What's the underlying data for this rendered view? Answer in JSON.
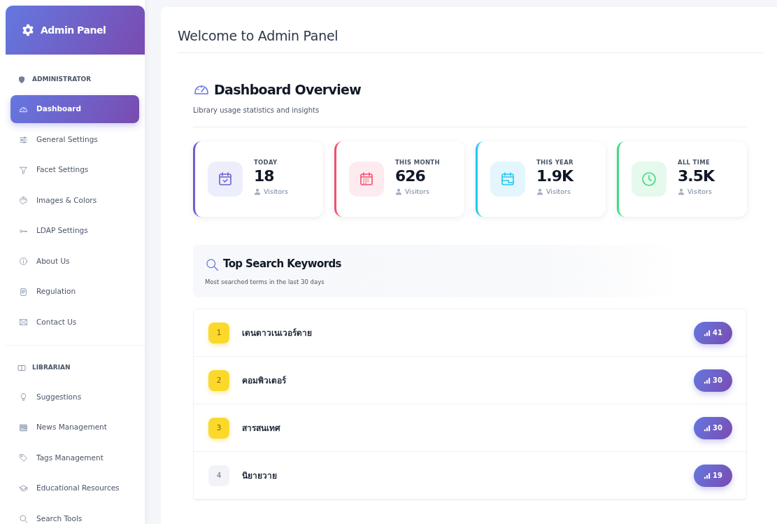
{
  "sidebar": {
    "brand": "Admin Panel",
    "items": [
      {
        "kind": "heading",
        "label": "ADMINISTRATOR"
      },
      {
        "kind": "link",
        "label": "Dashboard",
        "selected": true
      },
      {
        "kind": "link",
        "label": "General Settings",
        "selected": false
      },
      {
        "kind": "link",
        "label": "Facet Settings",
        "selected": false
      },
      {
        "kind": "link",
        "label": "Images & Colors",
        "selected": false
      },
      {
        "kind": "link",
        "label": "LDAP Settings",
        "selected": false
      },
      {
        "kind": "link",
        "label": "About Us",
        "selected": false
      },
      {
        "kind": "link",
        "label": "Regulation",
        "selected": false
      },
      {
        "kind": "link",
        "label": "Contact Us",
        "selected": false
      },
      {
        "kind": "divider"
      },
      {
        "kind": "heading",
        "label": "LIBRARIAN"
      },
      {
        "kind": "link",
        "label": "Suggestions",
        "selected": false
      },
      {
        "kind": "link",
        "label": "News Management",
        "selected": false
      },
      {
        "kind": "link",
        "label": "Tags Management",
        "selected": false
      },
      {
        "kind": "link",
        "label": "Educational Resources",
        "selected": false
      },
      {
        "kind": "link",
        "label": "Search Tools",
        "selected": false
      }
    ]
  },
  "page_title": "Welcome to Admin Panel",
  "overview": {
    "title": "Dashboard Overview",
    "subtitle": "Library usage statistics and insights"
  },
  "stats": [
    {
      "label": "TODAY",
      "value": "18",
      "unit": "Visitors",
      "color": "#6f5fd0"
    },
    {
      "label": "THIS MONTH",
      "value": "626",
      "unit": "Visitors",
      "color": "#f0506e"
    },
    {
      "label": "THIS YEAR",
      "value": "1.9K",
      "unit": "Visitors",
      "color": "#22c7f0"
    },
    {
      "label": "ALL TIME",
      "value": "3.5K",
      "unit": "Visitors",
      "color": "#3ddc84"
    }
  ],
  "keywords": {
    "title": "Top Search Keywords",
    "subtitle": "Most searched terms in the last 30 days",
    "rows": [
      {
        "rank": "1",
        "term": "เดนดาวเนเวอร์ดาย",
        "count": "41",
        "highlighted": true
      },
      {
        "rank": "2",
        "term": "คอมพิวเตอร์",
        "count": "30",
        "highlighted": true
      },
      {
        "rank": "3",
        "term": "สารสนเทศ",
        "count": "30",
        "highlighted": true
      },
      {
        "rank": "4",
        "term": "นิยายวาย",
        "count": "19",
        "highlighted": false
      }
    ]
  }
}
